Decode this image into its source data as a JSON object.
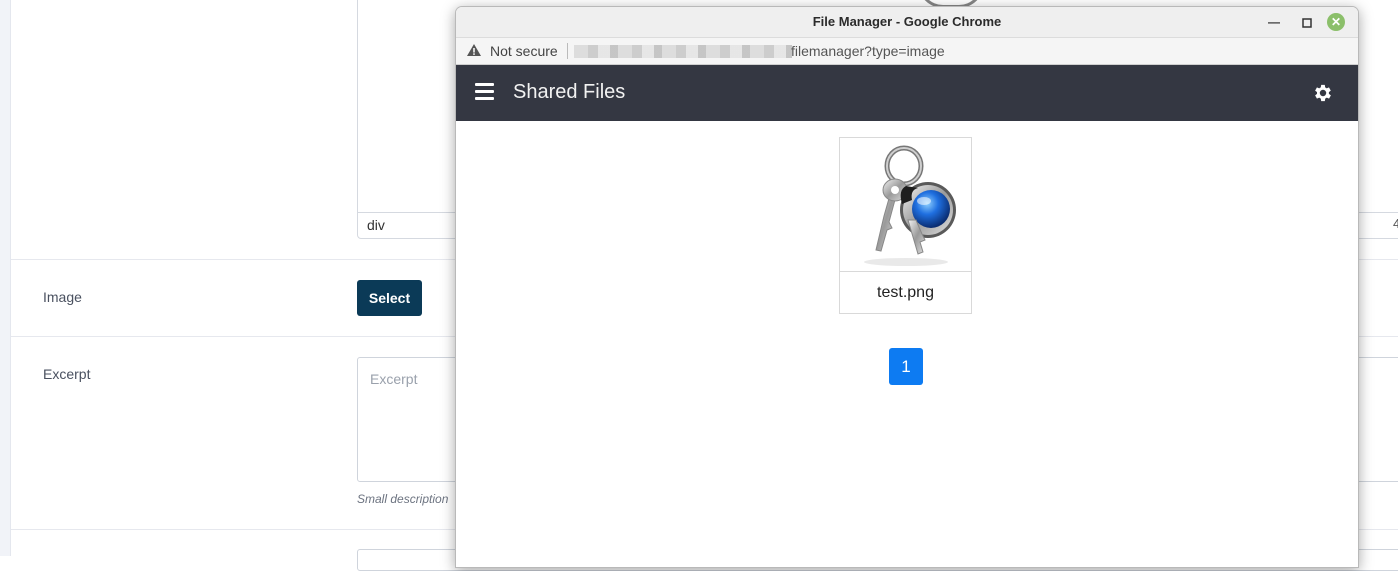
{
  "form": {
    "editor_status": "div",
    "image_label": "Image",
    "select_button": "Select",
    "excerpt_label": "Excerpt",
    "excerpt_placeholder": "Excerpt",
    "excerpt_help": "Small description",
    "editor_counter": "4"
  },
  "popup": {
    "window_title": "File Manager - Google Chrome",
    "security_label": "Not secure",
    "url_visible": "filemanager?type=image",
    "nav_title": "Shared Files",
    "files": [
      {
        "name": "test.png",
        "icon": "keychain-icon"
      }
    ],
    "pagination": {
      "current_page": "1"
    }
  },
  "colors": {
    "nav_bg": "#343742",
    "select_button_bg": "#0b3a57",
    "page_active": "#0d7bf2",
    "close_button": "#8bbf6a"
  }
}
